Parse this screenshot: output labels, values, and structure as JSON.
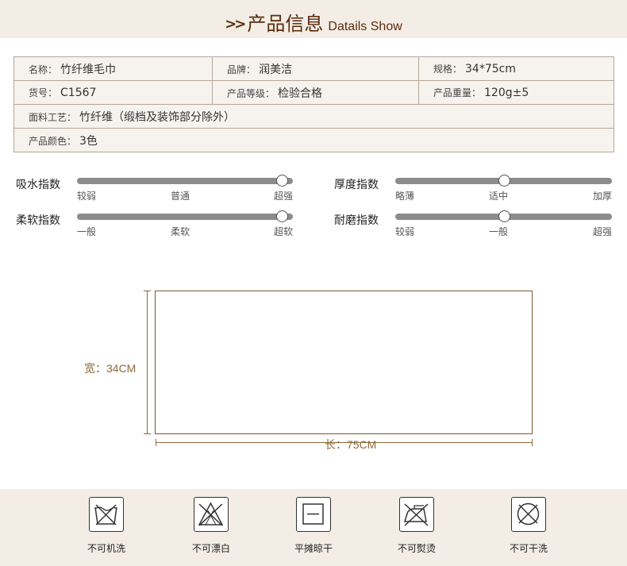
{
  "header": {
    "arrows": ">>",
    "title": "产品信息",
    "subtitle": "Datails Show"
  },
  "info": {
    "name": {
      "label": "名称：",
      "value": "竹纤维毛巾"
    },
    "brand": {
      "label": "品牌：",
      "value": "润美洁"
    },
    "spec": {
      "label": "规格：",
      "value": "34*75cm"
    },
    "sku": {
      "label": "货号：",
      "value": "C1567"
    },
    "grade": {
      "label": "产品等级：",
      "value": "检验合格"
    },
    "weight": {
      "label": "产品重量：",
      "value": "120g±5"
    },
    "material": {
      "label": "面料工艺：",
      "value": "竹纤维（缎档及装饰部分除外）"
    },
    "color": {
      "label": "产品颜色：",
      "value": "3色"
    }
  },
  "indices": [
    {
      "name": "吸水指数",
      "ticks": [
        "较弱",
        "普通",
        "超强"
      ],
      "level": 0.95
    },
    {
      "name": "厚度指数",
      "ticks": [
        "略薄",
        "适中",
        "加厚"
      ],
      "level": 0.5
    },
    {
      "name": "柔软指数",
      "ticks": [
        "一般",
        "柔软",
        "超软"
      ],
      "level": 0.95
    },
    {
      "name": "耐磨指数",
      "ticks": [
        "较弱",
        "一般",
        "超强"
      ],
      "level": 0.5
    }
  ],
  "diagram": {
    "width_label": "宽：34CM",
    "length_label": "长：75CM"
  },
  "care": [
    {
      "label": "不可机洗",
      "icon": "no-machine-wash-icon"
    },
    {
      "label": "不可漂白",
      "icon": "no-bleach-icon"
    },
    {
      "label": "平摊晾干",
      "icon": "dry-flat-icon"
    },
    {
      "label": "不可熨烫",
      "icon": "no-iron-icon"
    },
    {
      "label": "不可干洗",
      "icon": "no-dry-clean-icon"
    }
  ]
}
